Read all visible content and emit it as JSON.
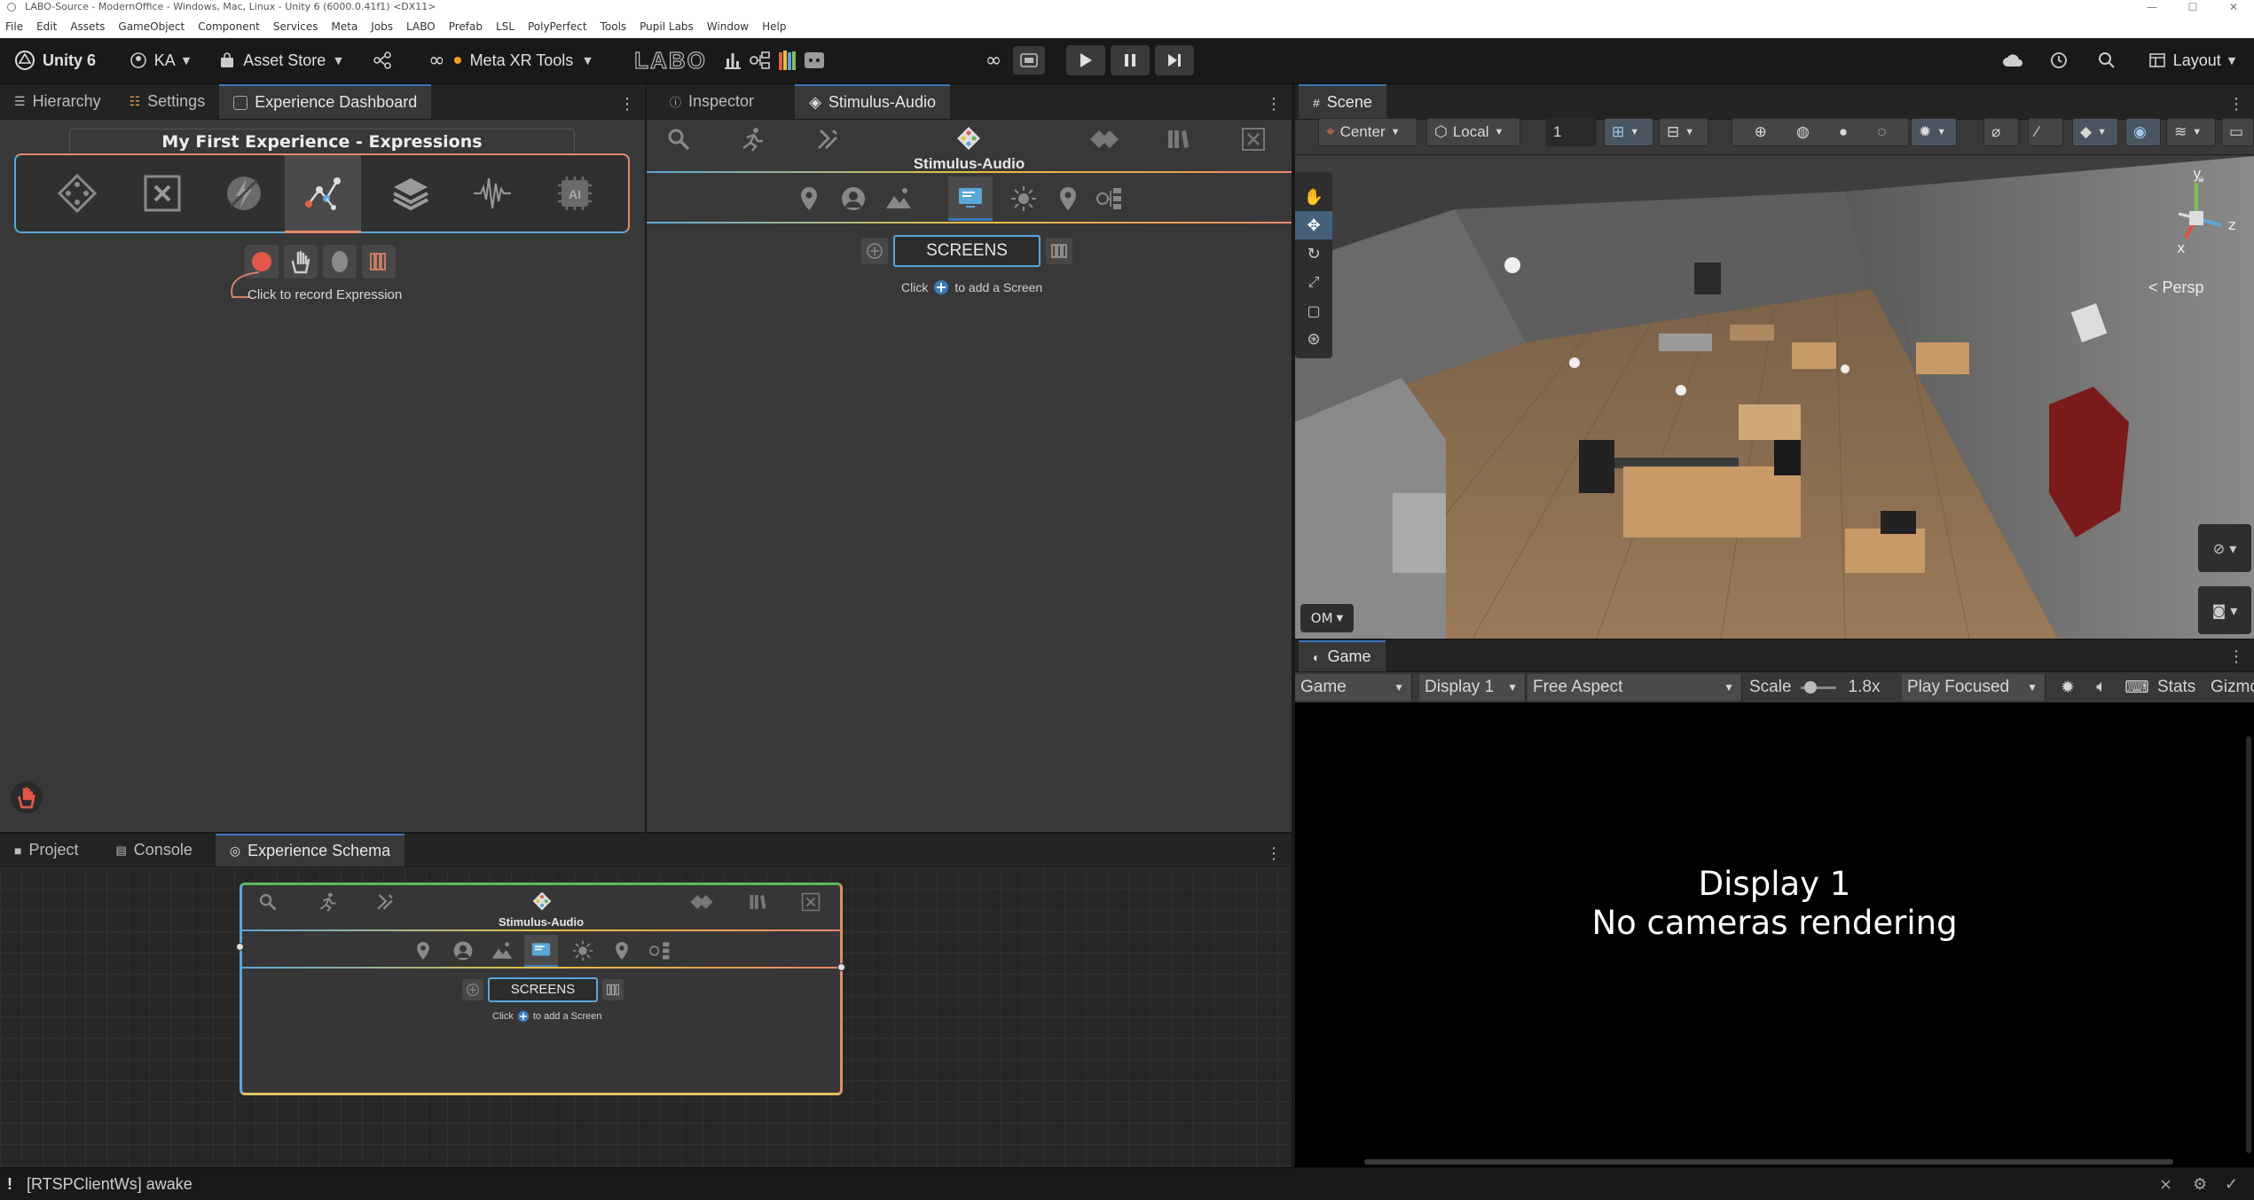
{
  "window": {
    "title": "LABO-Source - ModernOffice - Windows, Mac, Linux - Unity 6 (6000.0.41f1) <DX11>"
  },
  "menu": [
    "File",
    "Edit",
    "Assets",
    "GameObject",
    "Component",
    "Services",
    "Meta",
    "Jobs",
    "LABO",
    "Prefab",
    "LSL",
    "PolyPerfect",
    "Tools",
    "Pupil Labs",
    "Window",
    "Help"
  ],
  "toolbar": {
    "unity_label": "Unity 6",
    "account": "KA",
    "asset_store": "Asset Store",
    "meta_xr": "Meta XR Tools",
    "labo_logo": "LABO",
    "layout": "Layout"
  },
  "left_tabs": [
    "Hierarchy",
    "Settings",
    "Experience Dashboard"
  ],
  "dashboard": {
    "title": "My First Experience - Expressions",
    "record_hint": "Click to record Expression",
    "ai_label": "AI"
  },
  "inspector": {
    "tabs": [
      "Inspector",
      "Stimulus-Audio"
    ],
    "node_title": "Stimulus-Audio",
    "screens_label": "SCREENS",
    "add_hint_pre": "Click",
    "add_hint_post": "to add a Screen"
  },
  "bottom_tabs": [
    "Project",
    "Console",
    "Experience Schema"
  ],
  "schema_node": {
    "title": "Stimulus-Audio",
    "screens_label": "SCREENS",
    "add_hint_pre": "Click",
    "add_hint_post": "to add a Screen"
  },
  "scene": {
    "tab": "Scene",
    "pivot": "Center",
    "space": "Local",
    "grid_value": "1",
    "persp": "Persp",
    "axis_y": "y",
    "axis_z": "z",
    "axis_x": "x",
    "overlay_menu": "OM"
  },
  "game": {
    "tab": "Game",
    "view": "Game",
    "display": "Display 1",
    "aspect": "Free Aspect",
    "scale_label": "Scale",
    "scale_value": "1.8x",
    "play_mode": "Play Focused",
    "stats": "Stats",
    "gizmos": "Gizmo",
    "msg_line1": "Display 1",
    "msg_line2": "No cameras rendering"
  },
  "status": {
    "message": "[RTSPClientWs] awake"
  },
  "colors": {
    "accent": "#3a79bb",
    "record_red": "#e0584a",
    "selected_tab": "#4a4a4a",
    "schema_green": "#5cb85c",
    "schema_orange": "#e48a6a",
    "schema_blue": "#5aa7d8",
    "schema_yellow": "#e0c060"
  }
}
